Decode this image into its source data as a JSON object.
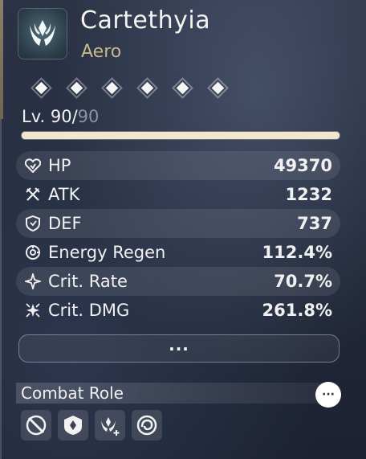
{
  "character": {
    "name": "Cartethyia",
    "element": "Aero",
    "element_color": "#c8b98a",
    "badge_icon": "aero-attribute-icon"
  },
  "resonance_chain": {
    "unlocked": 6,
    "total": 6,
    "icon": "diamond-icon"
  },
  "level": {
    "prefix": "Lv. 90/",
    "max": "90",
    "progress": 1.0
  },
  "stats": [
    {
      "label": "HP",
      "value": "49370",
      "icon": "hp-heart-icon"
    },
    {
      "label": "ATK",
      "value": "1232",
      "icon": "atk-swords-icon"
    },
    {
      "label": "DEF",
      "value": "737",
      "icon": "def-shield-icon"
    },
    {
      "label": "Energy Regen",
      "value": "112.4%",
      "icon": "energy-regen-icon"
    },
    {
      "label": "Crit. Rate",
      "value": "70.7%",
      "icon": "crit-rate-icon"
    },
    {
      "label": "Crit. DMG",
      "value": "261.8%",
      "icon": "crit-dmg-icon"
    }
  ],
  "more_button": {
    "label": "..."
  },
  "combat_role": {
    "title": "Combat Role",
    "info_label": "···",
    "roles": [
      {
        "icon": "slash-blade-icon"
      },
      {
        "icon": "shield-emblem-icon"
      },
      {
        "icon": "aero-plus-icon"
      },
      {
        "icon": "swirl-icon"
      }
    ]
  }
}
